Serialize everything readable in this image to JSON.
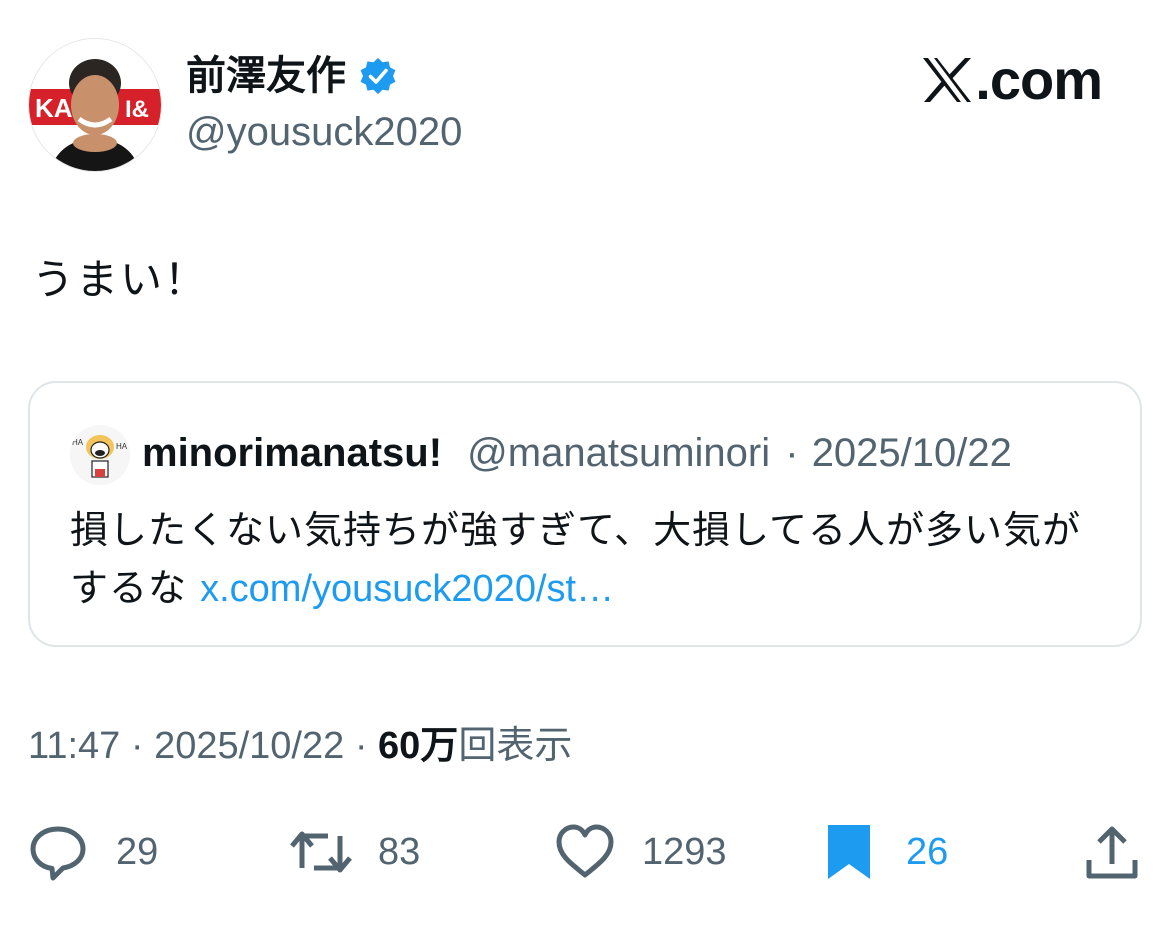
{
  "author": {
    "display_name": "前澤友作",
    "handle": "@yousuck2020",
    "verified": true,
    "avatar_icon": "profile-photo-icon"
  },
  "brand": {
    "text": ".com",
    "icon": "x-logo-icon"
  },
  "tweet": {
    "text": "うまい！"
  },
  "quote": {
    "author_name": "minorimanatsu!",
    "author_handle": "@manatsuminori",
    "date": "2025/10/22",
    "text": "損したくない気持ちが強すぎて、大損してる人が多い気がするな",
    "link": "x.com/yousuck2020/st…"
  },
  "meta": {
    "time": "11:47",
    "date": "2025/10/22",
    "views_count": "60万",
    "views_label": "回表示"
  },
  "actions": {
    "replies": "29",
    "retweets": "83",
    "likes": "1293",
    "bookmarks": "26"
  },
  "colors": {
    "accent": "#1d9bf0",
    "secondary_text": "#536471",
    "primary_text": "#0f1419",
    "border": "#dfe5e9"
  }
}
